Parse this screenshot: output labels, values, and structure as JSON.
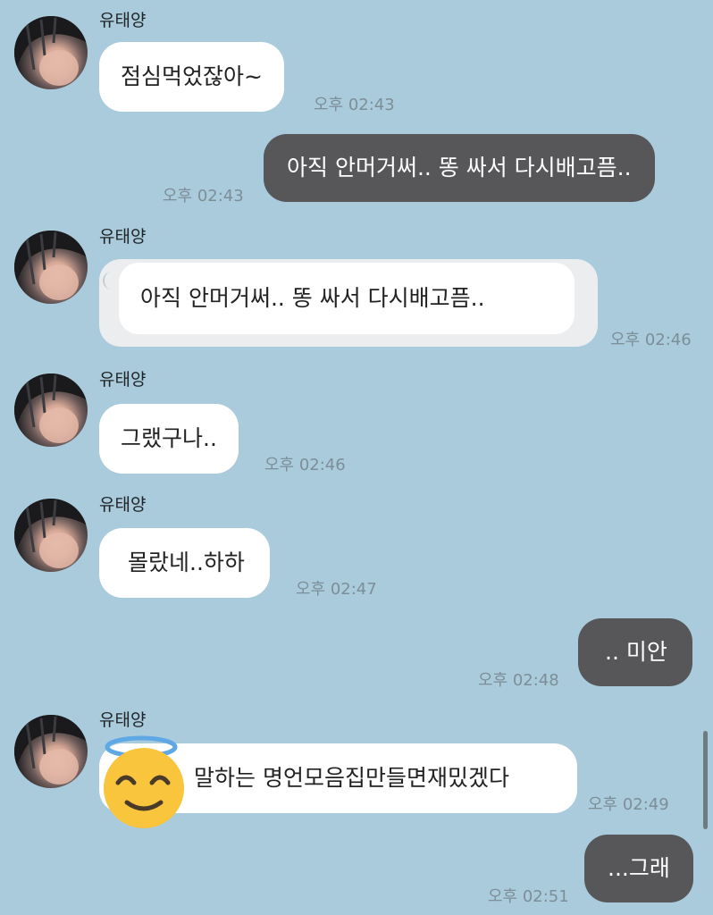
{
  "colors": {
    "background": "#a9cbdc",
    "incoming_bubble": "#ffffff",
    "outgoing_bubble": "#57575a",
    "time_text": "#7d8e98"
  },
  "messages": [
    {
      "sender": "유태양",
      "text": "점심먹었잖아~",
      "time": "오후 02:43",
      "direction": "in"
    },
    {
      "text": "아직 안머거써.. 똥 싸서 다시배고픔..",
      "time": "오후 02:43",
      "direction": "out"
    },
    {
      "sender": "유태양",
      "text": "아직 안머거써.. 똥 싸서 다시배고픔..",
      "time": "오후 02:46",
      "direction": "in",
      "type": "reply"
    },
    {
      "sender": "유태양",
      "text": "그랬구나..",
      "time": "오후 02:46",
      "direction": "in"
    },
    {
      "sender": "유태양",
      "text": "몰랐네..하하",
      "time": "오후 02:47",
      "direction": "in"
    },
    {
      "text": ".. 미안",
      "time": "오후 02:48",
      "direction": "out"
    },
    {
      "sender": "유태양",
      "text": "말하는 명언모음집만들면재밌겠다",
      "time": "오후 02:49",
      "direction": "in",
      "overlay_icon": "smiling-face-with-halo-icon"
    },
    {
      "text": "...그래",
      "time": "오후 02:51",
      "direction": "out"
    }
  ]
}
